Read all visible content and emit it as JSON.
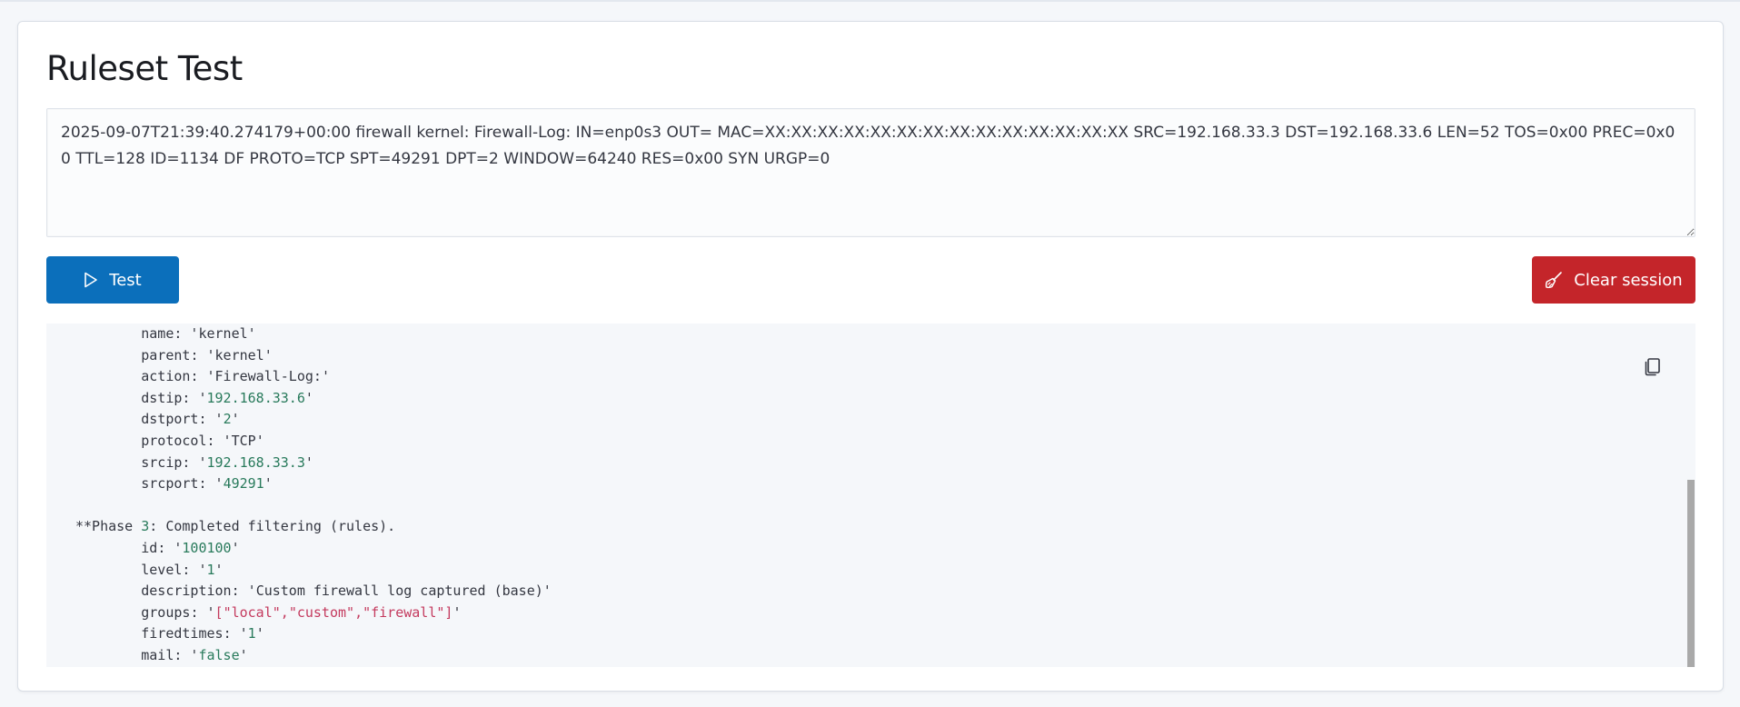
{
  "page": {
    "title": "Ruleset Test"
  },
  "input": {
    "log_text": "2025-09-07T21:39:40.274179+00:00 firewall kernel: Firewall-Log: IN=enp0s3 OUT= MAC=XX:XX:XX:XX:XX:XX:XX:XX:XX:XX:XX:XX:XX:XX SRC=192.168.33.3 DST=192.168.33.6 LEN=52 TOS=0x00 PREC=0x00 TTL=128 ID=1134 DF PROTO=TCP SPT=49291 DPT=2 WINDOW=64240 RES=0x00 SYN URGP=0"
  },
  "buttons": {
    "test_label": "Test",
    "clear_label": "Clear session",
    "test_icon": "play-icon",
    "clear_icon": "broom-icon"
  },
  "colors": {
    "primary": "#0b6fbb",
    "danger": "#c4252a",
    "string": "#287a5b",
    "array": "#c43a5e"
  },
  "output": {
    "copy_icon": "copy-icon",
    "lines": [
      {
        "indent": "        ",
        "key": "name",
        "value": "kernel",
        "style": "plain"
      },
      {
        "indent": "        ",
        "key": "parent",
        "value": "kernel",
        "style": "plain"
      },
      {
        "indent": "        ",
        "key": "action",
        "value": "Firewall-Log:",
        "style": "plain"
      },
      {
        "indent": "        ",
        "key": "dstip",
        "value": "192.168.33.6",
        "style": "str"
      },
      {
        "indent": "        ",
        "key": "dstport",
        "value": "2",
        "style": "str"
      },
      {
        "indent": "        ",
        "key": "protocol",
        "value": "TCP",
        "style": "plain"
      },
      {
        "indent": "        ",
        "key": "srcip",
        "value": "192.168.33.3",
        "style": "str"
      },
      {
        "indent": "        ",
        "key": "srcport",
        "value": "49291",
        "style": "str"
      },
      {
        "blank": true
      },
      {
        "phase": true,
        "prefix": "**Phase ",
        "num": "3",
        "text": ": Completed filtering (rules)."
      },
      {
        "indent": "        ",
        "key": "id",
        "value": "100100",
        "style": "str"
      },
      {
        "indent": "        ",
        "key": "level",
        "value": "1",
        "style": "str"
      },
      {
        "indent": "        ",
        "key": "description",
        "value": "Custom firewall log captured (base)",
        "style": "plain"
      },
      {
        "indent": "        ",
        "key": "groups",
        "value": "[\"local\",\"custom\",\"firewall\"]",
        "style": "arr"
      },
      {
        "indent": "        ",
        "key": "firedtimes",
        "value": "1",
        "style": "str"
      },
      {
        "indent": "        ",
        "key": "mail",
        "value": "false",
        "style": "str"
      }
    ]
  }
}
